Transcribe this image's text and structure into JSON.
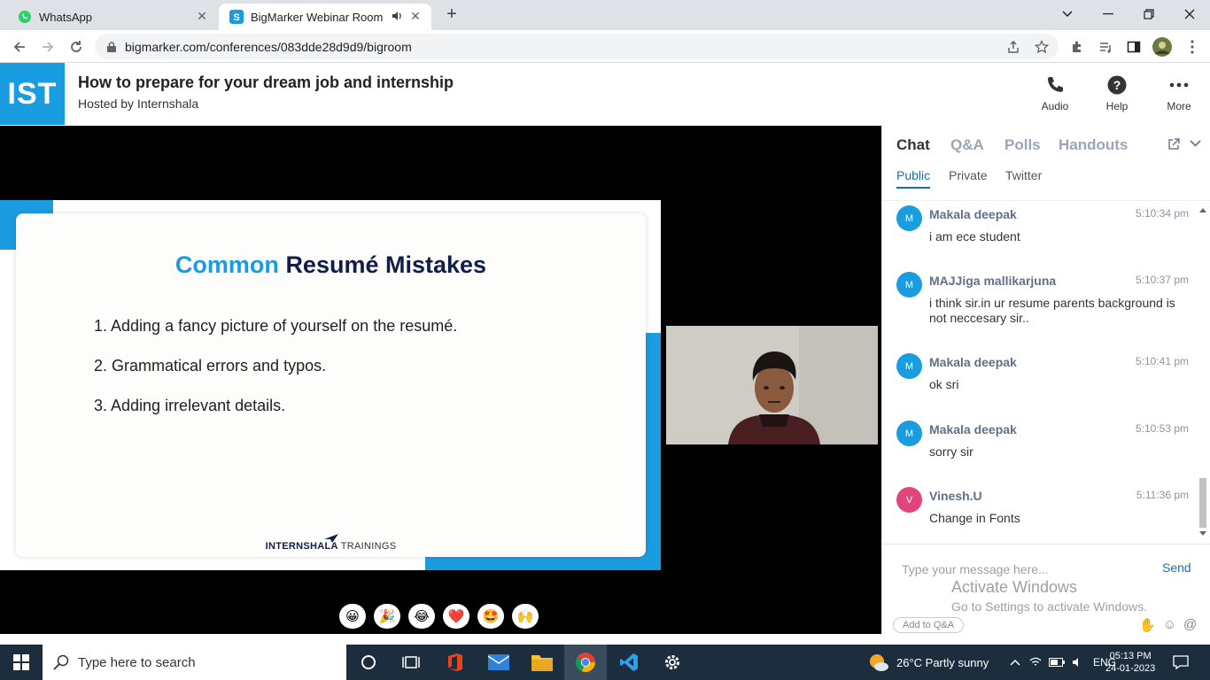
{
  "browser": {
    "tabs": [
      {
        "title": "WhatsApp",
        "favicon": "whatsapp-icon",
        "color": "#25d366"
      },
      {
        "title": "BigMarker Webinar Room",
        "favicon": "bigmarker-icon",
        "color": "#1a9ce0"
      }
    ],
    "url": "bigmarker.com/conferences/083dde28d9d9/bigroom"
  },
  "header": {
    "logo": "IST",
    "title": "How to prepare for your dream job and internship",
    "subtitle": "Hosted by Internshala",
    "buttons": {
      "audio": "Audio",
      "help": "Help",
      "more": "More"
    }
  },
  "slide": {
    "title_part1": "Common",
    "title_part2": "Resumé Mistakes",
    "items": [
      "1. Adding a fancy picture of yourself on the resumé.",
      "2. Grammatical errors and typos.",
      "3. Adding irrelevant details."
    ],
    "footer_bold": "INTERNSHALA",
    "footer_light": "TRAININGS"
  },
  "reactions": [
    "😀",
    "🎉",
    "😂",
    "❤️",
    "🤩",
    "🙌"
  ],
  "chat": {
    "tabs": [
      "Chat",
      "Q&A",
      "Polls",
      "Handouts"
    ],
    "subtabs": [
      "Public",
      "Private",
      "Twitter"
    ],
    "messages": [
      {
        "initial": "M",
        "name": "Makala deepak",
        "time": "5:10:34 pm",
        "text": "i am ece student",
        "color": "#1a9ce0"
      },
      {
        "initial": "M",
        "name": "MAJJiga mallikarjuna",
        "time": "5:10:37 pm",
        "text": "i think sir.in ur resume parents background is not neccesary sir..",
        "color": "#1a9ce0"
      },
      {
        "initial": "M",
        "name": "Makala deepak",
        "time": "5:10:41 pm",
        "text": "ok sri",
        "color": "#1a9ce0"
      },
      {
        "initial": "M",
        "name": "Makala deepak",
        "time": "5:10:53 pm",
        "text": "sorry sir",
        "color": "#1a9ce0"
      },
      {
        "initial": "V",
        "name": "Vinesh.U",
        "time": "5:11:36 pm",
        "text": "Change in Fonts",
        "color": "#e0457b"
      }
    ],
    "input_placeholder": "Type your message here...",
    "send": "Send",
    "add_to_qa": "Add to Q&A"
  },
  "watermark": {
    "line1": "Activate Windows",
    "line2": "Go to Settings to activate Windows."
  },
  "taskbar": {
    "search_placeholder": "Type here to search",
    "weather": "26°C  Partly sunny",
    "lang": "ENG",
    "time": "05:13 PM",
    "date": "24-01-2023"
  }
}
